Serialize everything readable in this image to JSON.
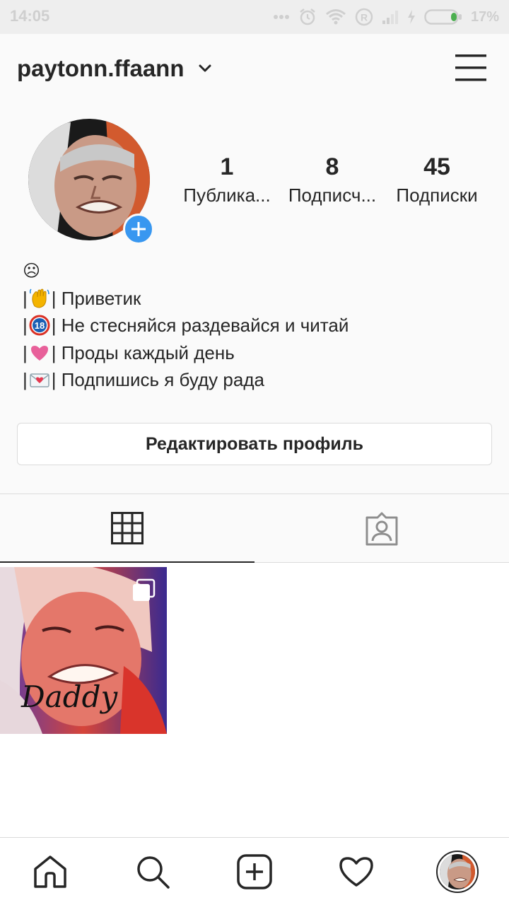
{
  "status_bar": {
    "time": "14:05",
    "battery_percent": "17%",
    "icons": [
      "more-dots-icon",
      "alarm-icon",
      "wifi-icon",
      "roaming-r-icon",
      "signal-icon",
      "charging-icon",
      "battery-icon"
    ]
  },
  "header": {
    "username": "paytonn.ffaann",
    "icons": [
      "chevron-down-icon",
      "menu-icon"
    ]
  },
  "stats": [
    {
      "value": "1",
      "label": "Публика..."
    },
    {
      "value": "8",
      "label": "Подписч..."
    },
    {
      "value": "45",
      "label": "Подписки"
    }
  ],
  "bio": {
    "line0": "☹",
    "line1": "| Приветик",
    "line2": "| Не стесняйся раздевайся и читай",
    "line3": "| Проды каждый день",
    "line4": "| Подпишись я буду рада"
  },
  "edit_profile_label": "Редактировать профиль",
  "tabs": [
    "grid-icon",
    "tagged-icon"
  ],
  "posts": [
    {
      "overlay_text": "Daddy",
      "type": "multiple-photos"
    }
  ],
  "bottom_nav": [
    "home-icon",
    "search-icon",
    "add-post-icon",
    "heart-icon",
    "profile-avatar"
  ],
  "colors": {
    "accent": "#3897f0",
    "text": "#262626",
    "border": "#dbdbdb",
    "background": "#fafafa"
  }
}
